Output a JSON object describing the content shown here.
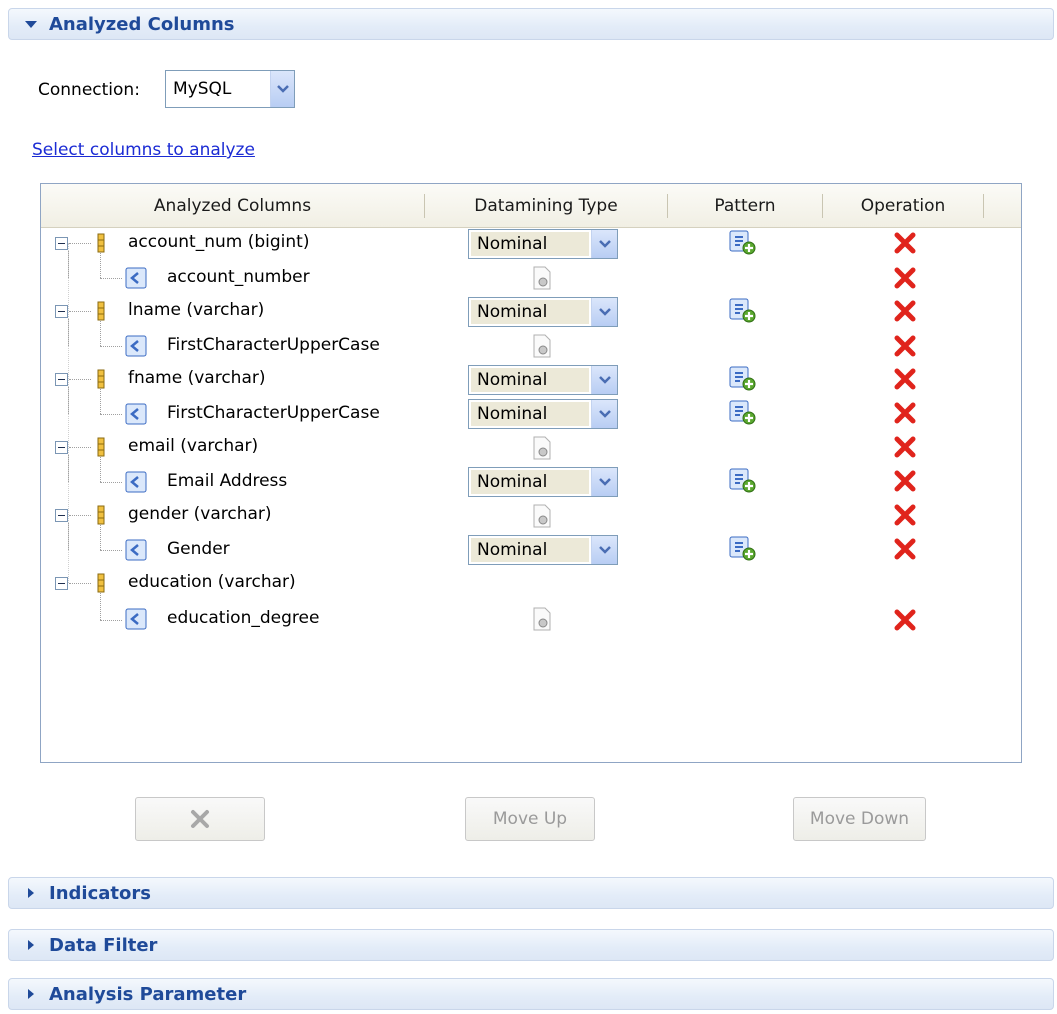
{
  "sections": {
    "analyzed_columns": "Analyzed Columns",
    "indicators": "Indicators",
    "data_filter": "Data Filter",
    "analysis_parameter": "Analysis Parameter"
  },
  "connection": {
    "label": "Connection:",
    "value": "MySQL"
  },
  "select_link": "Select columns to analyze",
  "table": {
    "headers": [
      "Analyzed Columns",
      "Datamining Type",
      "Pattern",
      "Operation"
    ],
    "rows": [
      {
        "label": "account_num (bigint)",
        "datamining": "Nominal"
      },
      {
        "label": "account_number"
      },
      {
        "label": "lname (varchar)",
        "datamining": "Nominal"
      },
      {
        "label": "FirstCharacterUpperCase"
      },
      {
        "label": "fname (varchar)",
        "datamining": "Nominal"
      },
      {
        "label": "FirstCharacterUpperCase",
        "datamining": "Nominal"
      },
      {
        "label": "email (varchar)"
      },
      {
        "label": "Email Address",
        "datamining": "Nominal"
      },
      {
        "label": "gender (varchar)"
      },
      {
        "label": "Gender",
        "datamining": "Nominal"
      },
      {
        "label": "education (varchar)"
      },
      {
        "label": "education_degree"
      }
    ]
  },
  "buttons": {
    "move_up": "Move Up",
    "move_down": "Move Down"
  },
  "colors": {
    "section_title": "#1f4a99",
    "link": "#1b2bd4",
    "delete_red": "#e0241c",
    "header_bg": "#e3ecf8"
  }
}
